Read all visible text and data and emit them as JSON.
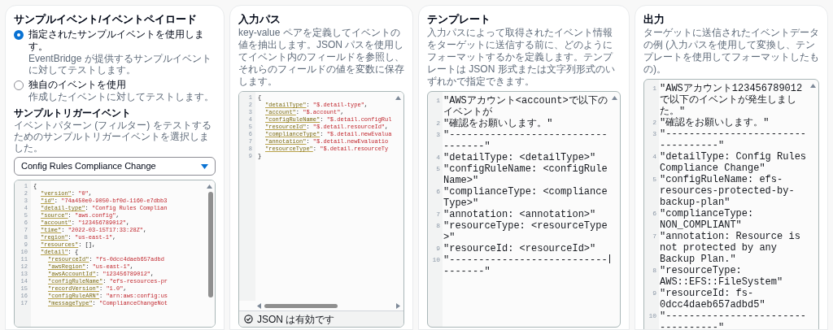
{
  "panels": [
    {
      "kind": "sample",
      "title": "サンプルイベント/イベントペイロード",
      "options": [
        {
          "label": "指定されたサンプルイベントを使用します。",
          "description": "EventBridge が提供するサンプルイベントに対してテストします。",
          "selected": true
        },
        {
          "label": "独自のイベントを使用",
          "description": "作成したイベントに対してテストします。",
          "selected": false
        }
      ],
      "trigger": {
        "title": "サンプルトリガーイベント",
        "description": "イベントパターン (フィルター) をテストするためのサンプルトリガーイベントを選択しました。",
        "value": "Config Rules Compliance Change"
      },
      "editor": {
        "lines": [
          {
            "n": "1",
            "tokens": [
              {
                "kind": "punct",
                "text": "{"
              }
            ],
            "children": [
              {
                "n": "2",
                "tokens": [
                  {
                    "kind": "key",
                    "text": "\"version\""
                  },
                  {
                    "kind": "punct",
                    "text": ": "
                  },
                  {
                    "kind": "string",
                    "text": "\"0\""
                  },
                  {
                    "kind": "punct",
                    "text": ","
                  }
                ]
              },
              {
                "n": "3",
                "tokens": [
                  {
                    "kind": "key",
                    "text": "\"id\""
                  },
                  {
                    "kind": "punct",
                    "text": ": "
                  },
                  {
                    "kind": "string",
                    "text": "\"74a450e0-9050-bf0d-1160-e7dbb3"
                  }
                ]
              },
              {
                "n": "4",
                "tokens": [
                  {
                    "kind": "key",
                    "text": "\"detail-type\""
                  },
                  {
                    "kind": "punct",
                    "text": ": "
                  },
                  {
                    "kind": "string",
                    "text": "\"Config Rules Complian"
                  }
                ]
              },
              {
                "n": "5",
                "tokens": [
                  {
                    "kind": "key",
                    "text": "\"source\""
                  },
                  {
                    "kind": "punct",
                    "text": ": "
                  },
                  {
                    "kind": "string",
                    "text": "\"aws.config\""
                  },
                  {
                    "kind": "punct",
                    "text": ","
                  }
                ]
              },
              {
                "n": "6",
                "tokens": [
                  {
                    "kind": "key",
                    "text": "\"account\""
                  },
                  {
                    "kind": "punct",
                    "text": ": "
                  },
                  {
                    "kind": "string",
                    "text": "\"123456789012\""
                  },
                  {
                    "kind": "punct",
                    "text": ","
                  }
                ]
              },
              {
                "n": "7",
                "tokens": [
                  {
                    "kind": "key",
                    "text": "\"time\""
                  },
                  {
                    "kind": "punct",
                    "text": ": "
                  },
                  {
                    "kind": "string",
                    "text": "\"2022-03-15T17:33:28Z\""
                  },
                  {
                    "kind": "punct",
                    "text": ","
                  }
                ]
              },
              {
                "n": "8",
                "tokens": [
                  {
                    "kind": "key",
                    "text": "\"region\""
                  },
                  {
                    "kind": "punct",
                    "text": ": "
                  },
                  {
                    "kind": "string",
                    "text": "\"us-east-1\""
                  },
                  {
                    "kind": "punct",
                    "text": ","
                  }
                ]
              },
              {
                "n": "9",
                "tokens": [
                  {
                    "kind": "key",
                    "text": "\"resources\""
                  },
                  {
                    "kind": "punct",
                    "text": ": [],"
                  }
                ]
              },
              {
                "n": "10",
                "tokens": [
                  {
                    "kind": "key",
                    "text": "\"detail\""
                  },
                  {
                    "kind": "punct",
                    "text": ": {"
                  }
                ],
                "children": [
                  {
                    "n": "11",
                    "tokens": [
                      {
                        "kind": "key",
                        "text": "\"resourceId\""
                      },
                      {
                        "kind": "punct",
                        "text": ": "
                      },
                      {
                        "kind": "string",
                        "text": "\"fs-0dcc4daeb657adbd"
                      }
                    ]
                  },
                  {
                    "n": "12",
                    "tokens": [
                      {
                        "kind": "key",
                        "text": "\"awsRegion\""
                      },
                      {
                        "kind": "punct",
                        "text": ": "
                      },
                      {
                        "kind": "string",
                        "text": "\"us-east-1\""
                      },
                      {
                        "kind": "punct",
                        "text": ","
                      }
                    ]
                  },
                  {
                    "n": "13",
                    "tokens": [
                      {
                        "kind": "key",
                        "text": "\"awsAccountId\""
                      },
                      {
                        "kind": "punct",
                        "text": ": "
                      },
                      {
                        "kind": "string",
                        "text": "\"123456789012\""
                      },
                      {
                        "kind": "punct",
                        "text": ","
                      }
                    ]
                  },
                  {
                    "n": "14",
                    "tokens": [
                      {
                        "kind": "key",
                        "text": "\"configRuleName\""
                      },
                      {
                        "kind": "punct",
                        "text": ": "
                      },
                      {
                        "kind": "string",
                        "text": "\"efs-resources-pr"
                      }
                    ]
                  },
                  {
                    "n": "15",
                    "tokens": [
                      {
                        "kind": "key",
                        "text": "\"recordVersion\""
                      },
                      {
                        "kind": "punct",
                        "text": ": "
                      },
                      {
                        "kind": "string",
                        "text": "\"1.0\""
                      },
                      {
                        "kind": "punct",
                        "text": ","
                      }
                    ]
                  },
                  {
                    "n": "16",
                    "tokens": [
                      {
                        "kind": "key",
                        "text": "\"configRuleARN\""
                      },
                      {
                        "kind": "punct",
                        "text": ": "
                      },
                      {
                        "kind": "string",
                        "text": "\"arn:aws:config:us"
                      }
                    ]
                  },
                  {
                    "n": "17",
                    "tokens": [
                      {
                        "kind": "key",
                        "text": "\"messageType\""
                      },
                      {
                        "kind": "punct",
                        "text": ": "
                      },
                      {
                        "kind": "string",
                        "text": "\"ComplianceChangeNot"
                      }
                    ]
                  }
                ]
              }
            ]
          }
        ]
      }
    },
    {
      "kind": "paths",
      "title": "入力パス",
      "description": "key-value ペアを定義してイベントの値を抽出します。JSON パスを使用してイベント内のフィールドを参照し、それらのフィールドの値を変数に保存します。",
      "editor": {
        "status": "JSON は有効です",
        "lines": [
          {
            "n": "1",
            "tokens": [
              {
                "kind": "punct",
                "text": "{"
              }
            ],
            "children": [
              {
                "n": "2",
                "tokens": [
                  {
                    "kind": "key",
                    "text": "\"detailType\""
                  },
                  {
                    "kind": "punct",
                    "text": ": "
                  },
                  {
                    "kind": "string",
                    "text": "\"$.detail-type\""
                  },
                  {
                    "kind": "punct",
                    "text": ","
                  }
                ]
              },
              {
                "n": "3",
                "tokens": [
                  {
                    "kind": "key",
                    "text": "\"account\""
                  },
                  {
                    "kind": "punct",
                    "text": ": "
                  },
                  {
                    "kind": "string",
                    "text": "\"$.account\""
                  },
                  {
                    "kind": "punct",
                    "text": ","
                  }
                ]
              },
              {
                "n": "4",
                "tokens": [
                  {
                    "kind": "key",
                    "text": "\"configRuleName\""
                  },
                  {
                    "kind": "punct",
                    "text": ": "
                  },
                  {
                    "kind": "string",
                    "text": "\"$.detail.configRul"
                  }
                ]
              },
              {
                "n": "5",
                "tokens": [
                  {
                    "kind": "key",
                    "text": "\"resourceId\""
                  },
                  {
                    "kind": "punct",
                    "text": ": "
                  },
                  {
                    "kind": "string",
                    "text": "\"$.detail.resourceId\""
                  },
                  {
                    "kind": "punct",
                    "text": ","
                  }
                ]
              },
              {
                "n": "6",
                "tokens": [
                  {
                    "kind": "key",
                    "text": "\"complianceType\""
                  },
                  {
                    "kind": "punct",
                    "text": ": "
                  },
                  {
                    "kind": "string",
                    "text": "\"$.detail.newEvalua"
                  }
                ]
              },
              {
                "n": "7",
                "tokens": [
                  {
                    "kind": "key",
                    "text": "\"annotation\""
                  },
                  {
                    "kind": "punct",
                    "text": ": "
                  },
                  {
                    "kind": "string",
                    "text": "\"$.detail.newEvaluatio"
                  }
                ]
              },
              {
                "n": "8",
                "tokens": [
                  {
                    "kind": "key",
                    "text": "\"resourceType\""
                  },
                  {
                    "kind": "punct",
                    "text": ": "
                  },
                  {
                    "kind": "string",
                    "text": "\"$.detail.resourceTy"
                  }
                ]
              }
            ]
          },
          {
            "n": "9",
            "tokens": [
              {
                "kind": "punct",
                "text": "}"
              }
            ]
          }
        ]
      }
    },
    {
      "kind": "template",
      "title": "テンプレート",
      "description": "入力パスによって取得されたイベント情報をターゲットに送信する前に、どのようにフォーマットするかを定義します。テンプレートは JSON 形式または文字列形式のいずれかで指定できます。",
      "editor": {
        "lines": [
          {
            "n": "1",
            "text": "\"AWSアカウント<account>で以下のイベントが"
          },
          {
            "n": "2",
            "text": "\"確認をお願いします。\""
          },
          {
            "n": "3",
            "text": "\"----------------------------------\""
          },
          {
            "n": "4",
            "text": "\"detailType: <detailType>\""
          },
          {
            "n": "5",
            "text": "\"configRuleName: <configRuleName>\""
          },
          {
            "n": "6",
            "text": "\"complianceType: <complianceType>\""
          },
          {
            "n": "7",
            "text": "\"annotation: <annotation>\""
          },
          {
            "n": "8",
            "text": "\"resourceType: <resourceType>\""
          },
          {
            "n": "9",
            "text": "\"resourceId: <resourceId>\""
          },
          {
            "n": "10",
            "text": "\"----------------------------------\"",
            "cursor": true
          }
        ]
      }
    },
    {
      "kind": "output",
      "title": "出力",
      "description": "ターゲットに送信されたイベントデータの例 (入力パスを使用して変換し、テンプレートを使用してフォーマットしたもの)。",
      "editor": {
        "lines": [
          {
            "n": "1",
            "text": "\"AWSアカウント123456789012で以下のイベントが発生しました。\""
          },
          {
            "n": "2",
            "text": "\"確認をお願いします。\""
          },
          {
            "n": "3",
            "text": "\"----------------------------------\""
          },
          {
            "n": "4",
            "text": "\"detailType: Config Rules Compliance Change\""
          },
          {
            "n": "5",
            "text": "\"configRuleName: efs-resources-protected-by-backup-plan\""
          },
          {
            "n": "6",
            "text": "\"complianceType: NON_COMPLIANT\""
          },
          {
            "n": "7",
            "text": "\"annotation: Resource is not protected by any Backup Plan.\""
          },
          {
            "n": "8",
            "text": "\"resourceType: AWS::EFS::FileSystem\""
          },
          {
            "n": "9",
            "text": "\"resourceId: fs-0dcc4daeb657adbd5\""
          },
          {
            "n": "10",
            "text": "\"----------------------------------\""
          }
        ]
      }
    }
  ]
}
